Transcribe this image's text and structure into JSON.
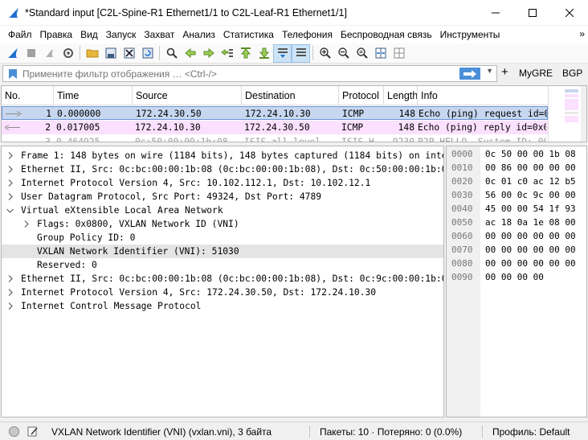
{
  "window": {
    "title": "*Standard input [C2L-Spine-R1 Ethernet1/1 to C2L-Leaf-R1 Ethernet1/1]"
  },
  "menu": {
    "items": [
      "Файл",
      "Правка",
      "Вид",
      "Запуск",
      "Захват",
      "Анализ",
      "Статистика",
      "Телефония",
      "Беспроводная связь",
      "Инструменты"
    ],
    "more": "»"
  },
  "filter": {
    "placeholder": "Примените фильтр отображения … <Ctrl-/>",
    "buttons": [
      "MyGRE",
      "BGP"
    ],
    "add_label": "+"
  },
  "packet_list": {
    "columns": [
      "No.",
      "Time",
      "Source",
      "Destination",
      "Protocol",
      "Length",
      "Info"
    ],
    "rows": [
      {
        "no": "1",
        "time": "0.000000",
        "source": "172.24.30.50",
        "destination": "172.24.10.30",
        "protocol": "ICMP",
        "length": "148",
        "info": "Echo (ping) request  id=0x0"
      },
      {
        "no": "2",
        "time": "0.017005",
        "source": "172.24.10.30",
        "destination": "172.24.30.50",
        "protocol": "ICMP",
        "length": "148",
        "info": "Echo (ping) reply    id=0x0"
      },
      {
        "no": "3",
        "time": "0.464925",
        "source": "0c:50:00:00:1b:08",
        "destination": "ISIS-all-level-…",
        "protocol": "ISIS H…",
        "length": "9230",
        "info": "P2P HELLO, System-ID: 0000."
      }
    ]
  },
  "details": {
    "rows": [
      {
        "text": "Frame 1: 148 bytes on wire (1184 bits), 148 bytes captured (1184 bits) on interface",
        "indent": 0,
        "expanded": false
      },
      {
        "text": "Ethernet II, Src: 0c:bc:00:00:1b:08 (0c:bc:00:00:1b:08), Dst: 0c:50:00:00:1b:08 (0c",
        "indent": 0,
        "expanded": false
      },
      {
        "text": "Internet Protocol Version 4, Src: 10.102.112.1, Dst: 10.102.12.1",
        "indent": 0,
        "expanded": false
      },
      {
        "text": "User Datagram Protocol, Src Port: 49324, Dst Port: 4789",
        "indent": 0,
        "expanded": false
      },
      {
        "text": "Virtual eXtensible Local Area Network",
        "indent": 0,
        "expanded": true
      },
      {
        "text": "Flags: 0x0800, VXLAN Network ID (VNI)",
        "indent": 1,
        "expanded": false
      },
      {
        "text": "Group Policy ID: 0",
        "indent": 2,
        "expanded": null
      },
      {
        "text": "VXLAN Network Identifier (VNI): 51030",
        "indent": 2,
        "expanded": null
      },
      {
        "text": "Reserved: 0",
        "indent": 2,
        "expanded": null
      },
      {
        "text": "Ethernet II, Src: 0c:bc:00:00:1b:08 (0c:bc:00:00:1b:08), Dst: 0c:9c:00:00:1b:08 (0c",
        "indent": 0,
        "expanded": false
      },
      {
        "text": "Internet Protocol Version 4, Src: 172.24.30.50, Dst: 172.24.10.30",
        "indent": 0,
        "expanded": false
      },
      {
        "text": "Internet Control Message Protocol",
        "indent": 0,
        "expanded": false
      }
    ],
    "selected_index": 7
  },
  "bytes": {
    "rows": [
      {
        "offset": "0000",
        "hex": "0c 50 00 00 1b 08"
      },
      {
        "offset": "0010",
        "hex": "00 86 00 00 00 00"
      },
      {
        "offset": "0020",
        "hex": "0c 01 c0 ac 12 b5"
      },
      {
        "offset": "0030",
        "hex": "56 00 0c 9c 00 00"
      },
      {
        "offset": "0040",
        "hex": "45 00 00 54 1f 93"
      },
      {
        "offset": "0050",
        "hex": "ac 18 0a 1e 08 00"
      },
      {
        "offset": "0060",
        "hex": "00 00 00 00 00 00"
      },
      {
        "offset": "0070",
        "hex": "00 00 00 00 00 00"
      },
      {
        "offset": "0080",
        "hex": "00 00 00 00 00 00"
      },
      {
        "offset": "0090",
        "hex": "00 00 00 00"
      }
    ]
  },
  "status": {
    "field": "VXLAN Network Identifier (VNI) (vxlan.vni), 3 байта",
    "packets": "Пакеты: 10 · Потеряно: 0 (0.0%)",
    "profile": "Профиль: Default"
  },
  "colors": {
    "selected_row": "#c6d7ef",
    "icmp_reply_row": "#fce0ff",
    "selected_field": "#e4e4e4",
    "accent": "#4a8fd8"
  }
}
